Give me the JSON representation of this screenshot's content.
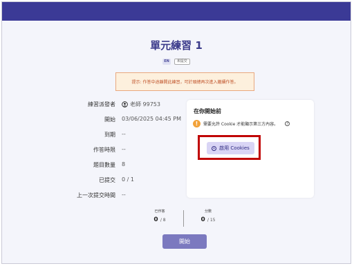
{
  "header": {
    "bar_color": "#3b3a96"
  },
  "title": "單元練習 1",
  "language_badge": "EN",
  "status_badge": "未提交",
  "notice": "提示: 作答中途離開此練習，可於頭總再次進入繼續作答。",
  "info": [
    {
      "label": "練習派發者",
      "value": "老師 99753",
      "icon": "user-icon"
    },
    {
      "label": "開始",
      "value": "03/06/2025 04:45 PM"
    },
    {
      "label": "到期",
      "value": "--"
    },
    {
      "label": "作答時限",
      "value": "--"
    },
    {
      "label": "題目數量",
      "value": "8"
    },
    {
      "label": "已提交",
      "value": "0 / 1"
    },
    {
      "label": "上一次提交時間",
      "value": "--"
    }
  ],
  "card": {
    "title": "在你開始前",
    "warning": "需要允許 Cookie 才能顯示第三方內容。",
    "help": "?",
    "button_label": "啟用 Cookies",
    "highlight_color": "#c00000"
  },
  "stats": {
    "answered": {
      "label": "已作答",
      "value": "0",
      "total": "/ 8"
    },
    "score": {
      "label": "分數",
      "value": "0",
      "total": "/ 15"
    }
  },
  "start_button": "開始"
}
